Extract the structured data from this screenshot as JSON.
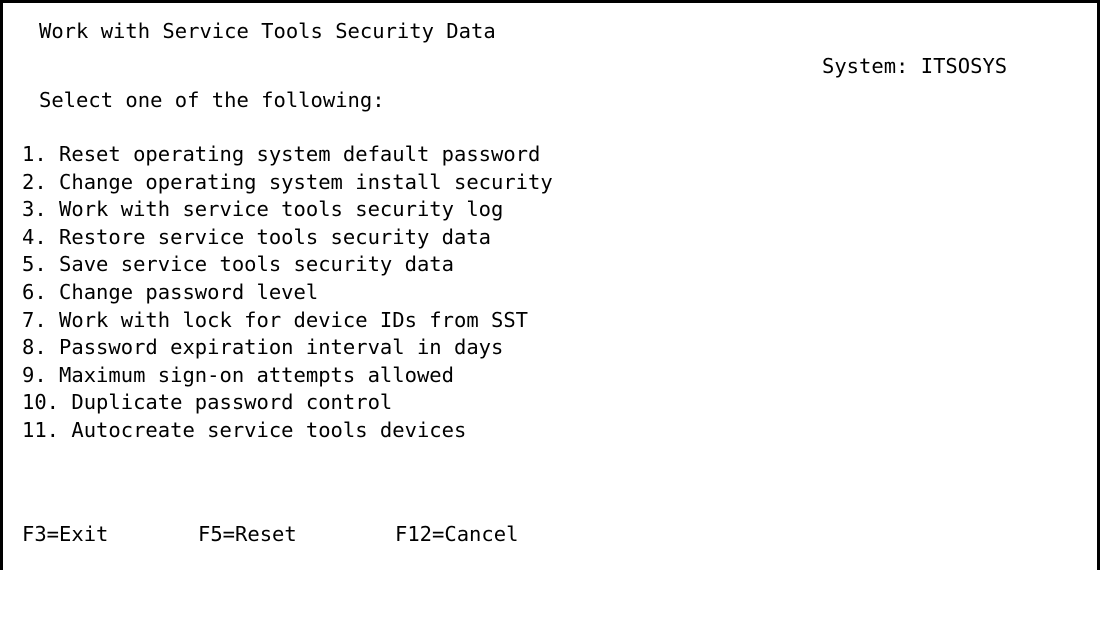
{
  "screen": {
    "title": "Work with Service Tools Security Data",
    "system_label": "System:",
    "system_name": "ITSOSYS",
    "prompt": "Select one of the following:"
  },
  "menu": {
    "items": [
      {
        "label": "1. Reset operating system default password"
      },
      {
        "label": "2. Change operating system install security"
      },
      {
        "label": "3. Work with service tools security log"
      },
      {
        "label": "4. Restore service tools security data"
      },
      {
        "label": "5. Save service tools security data"
      },
      {
        "label": "6. Change password level"
      },
      {
        "label": "7. Work with lock for device IDs from SST"
      },
      {
        "label": "8. Password expiration interval in days"
      },
      {
        "label": "9. Maximum sign-on attempts allowed"
      },
      {
        "label": "10. Duplicate password control"
      },
      {
        "label": "11. Autocreate service tools devices"
      }
    ]
  },
  "function_keys": [
    {
      "label": "F3=Exit"
    },
    {
      "label": "F5=Reset"
    },
    {
      "label": "F12=Cancel"
    }
  ]
}
